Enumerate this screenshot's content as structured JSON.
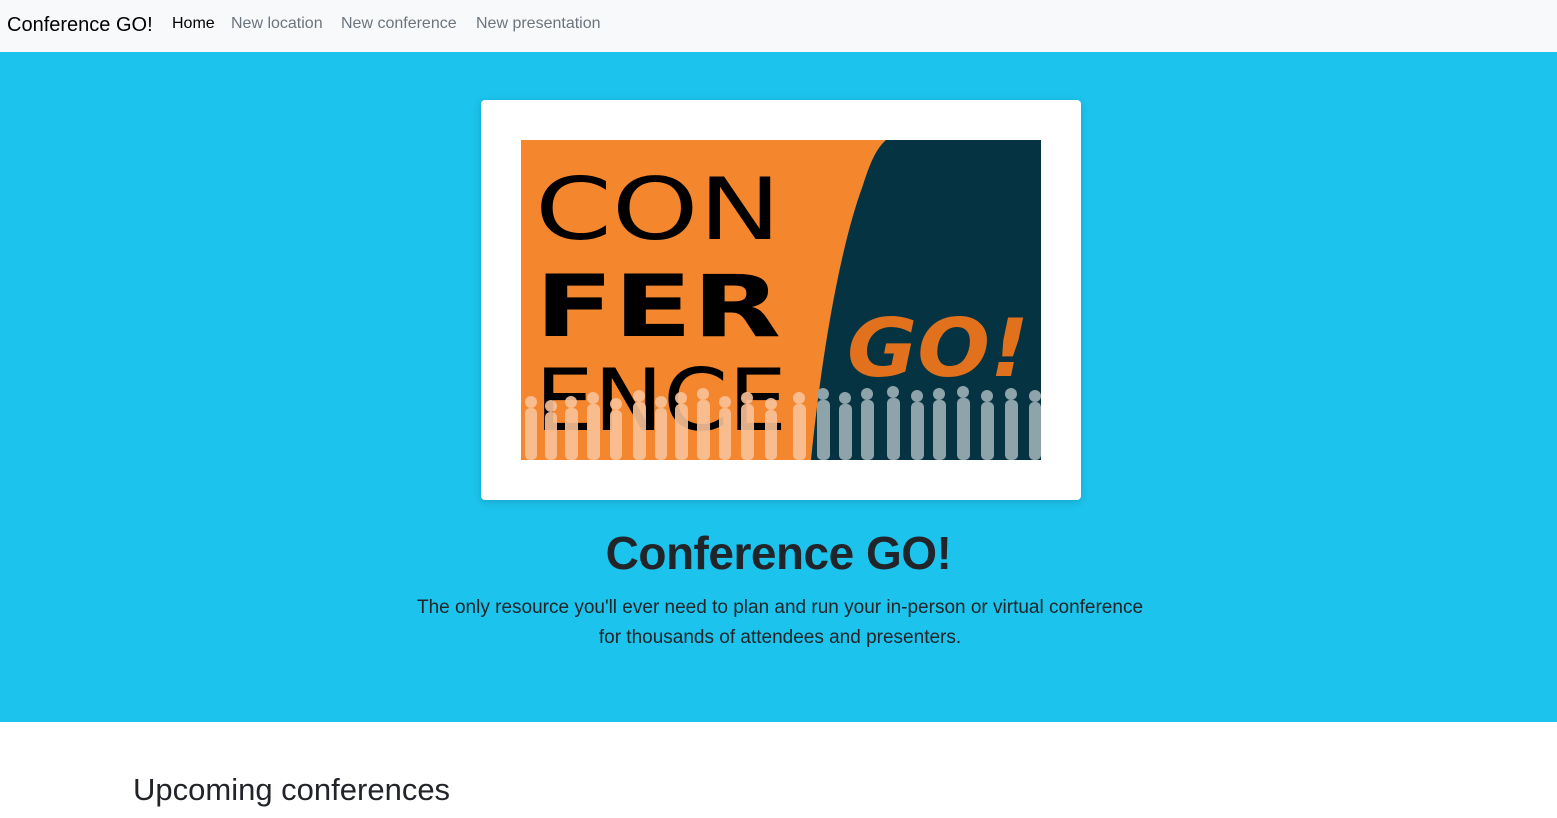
{
  "navbar": {
    "brand": "Conference GO!",
    "items": [
      {
        "label": "Home",
        "active": true
      },
      {
        "label": "New location",
        "active": false
      },
      {
        "label": "New conference",
        "active": false
      },
      {
        "label": "New presentation",
        "active": false
      }
    ]
  },
  "hero": {
    "logo": {
      "line1": "CON",
      "line2": "FER",
      "line3": "ENCE",
      "go": "GO!"
    },
    "title": "Conference GO!",
    "lead_line1": "The only resource you'll ever need to plan and run your in-person or virtual conference",
    "lead_line2": "for thousands of attendees and presenters."
  },
  "content": {
    "section_title": "Upcoming conferences"
  },
  "colors": {
    "navbar_bg": "#f8f9fa",
    "hero_bg": "#1cc3ec",
    "logo_orange": "#f4862e",
    "logo_navy": "#053342",
    "go_orange": "#e2711d",
    "silhouette_light": "#f9c29a",
    "silhouette_gray": "#8fa3aa"
  }
}
